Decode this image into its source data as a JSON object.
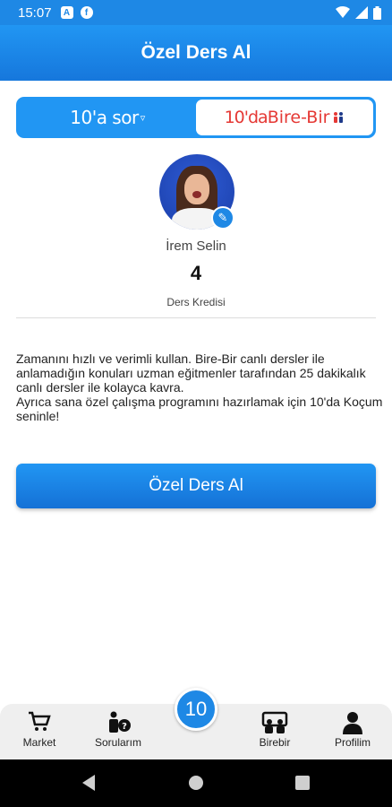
{
  "status_bar": {
    "time": "15:07",
    "icon_a": "A",
    "icon_f": "f"
  },
  "header": {
    "title": "Özel Ders Al"
  },
  "toggle": {
    "left_label": "10'a sor",
    "right_prefix": "10'da",
    "right_label": "Bire-Bir"
  },
  "profile": {
    "name": "İrem Selin",
    "credits": "4",
    "credits_label": "Ders Kredisi"
  },
  "description": {
    "paragraph1": "Zamanını hızlı ve verimli kullan. Bire-Bir canlı dersler ile anlamadığın konuları uzman eğitmenler tarafından 25 dakikalık canlı dersler ile kolayca kavra.",
    "paragraph2": "Ayrıca sana özel çalışma programını hazırlamak için 10'da Koçum seninle!"
  },
  "cta": {
    "label": "Özel Ders Al"
  },
  "bottom_nav": {
    "center_label": "10",
    "items": [
      {
        "label": "Market",
        "icon": "cart-icon"
      },
      {
        "label": "Sorularım",
        "icon": "question-person-icon"
      },
      {
        "label": "Birebir",
        "icon": "presentation-icon"
      },
      {
        "label": "Profilim",
        "icon": "person-icon"
      }
    ]
  },
  "colors": {
    "primary": "#1e88e5",
    "accent_red": "#e53935"
  }
}
